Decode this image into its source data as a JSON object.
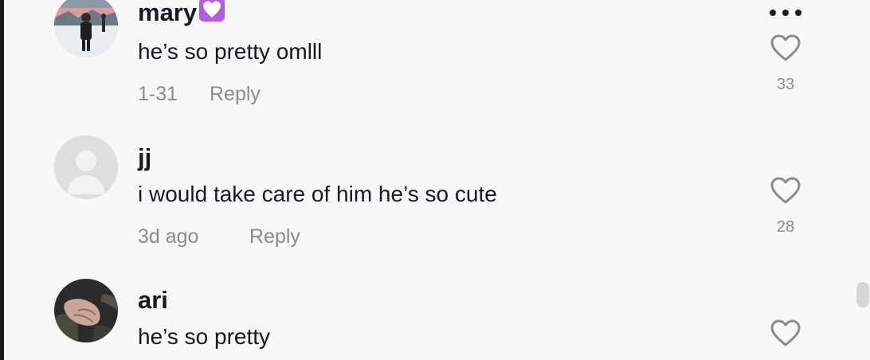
{
  "comments": [
    {
      "username": "mary",
      "username_emoji": "💟",
      "text": "he’s so pretty omlll",
      "date": "1-31",
      "reply_label": "Reply",
      "likes": "33",
      "avatar": "photo-person-snow"
    },
    {
      "username": "jj",
      "text": "i would take care of him he’s so cute",
      "date": "3d ago",
      "reply_label": "Reply",
      "likes": "28",
      "avatar": "default-avatar"
    },
    {
      "username": "ari",
      "text": "he’s so pretty",
      "avatar": "photo-hands-dark"
    }
  ],
  "icons": {
    "like": "heart-outline-icon",
    "more": "more-options-icon"
  },
  "colors": {
    "background": "#f8f8f8",
    "primary_text": "#161823",
    "secondary_text": "#8a8b91",
    "emoji_heart": "#b05ce0"
  }
}
